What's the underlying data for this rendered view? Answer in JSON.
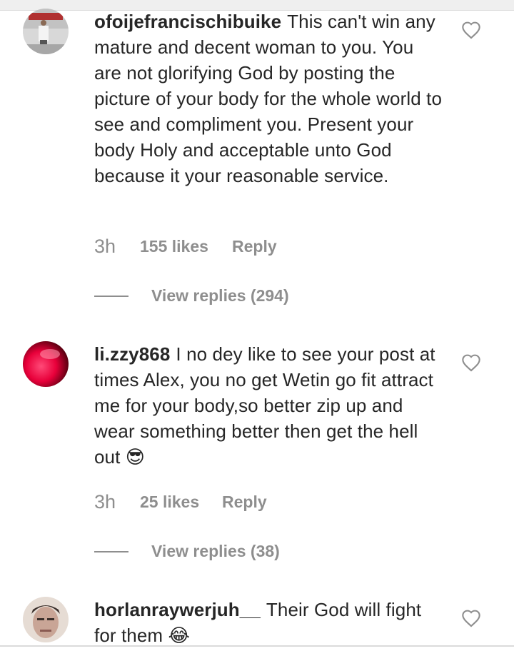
{
  "comments": [
    {
      "username": "ofoijefrancischibuike",
      "text": "This can't win any mature and decent woman to you. You are not glorifying God by posting the picture of your body for the whole world to see and compliment you. Present your body Holy and acceptable unto God because it your reasonable service.",
      "time": "3h",
      "likes": "155 likes",
      "reply": "Reply",
      "view_replies": "View replies (294)",
      "avatar_colors": [
        "#b9b9b9",
        "#e5e5e5"
      ]
    },
    {
      "username": "li.zzy868",
      "text": "I no dey like to see your post at times Alex, you no get Wetin go fit attract me for your body,so better zip up and wear something better then get the hell out",
      "emoji": "😎",
      "time": "3h",
      "likes": "25 likes",
      "reply": "Reply",
      "view_replies": "View replies (38)",
      "avatar_colors": [
        "#ff1a4e",
        "#5a0010"
      ]
    },
    {
      "username": "horlanraywerjuh__",
      "text": "Their God will fight for them",
      "emoji": "😂",
      "avatar_colors": [
        "#d9cfc8",
        "#6b5d5a"
      ]
    }
  ],
  "icons": {
    "heart": "heart-outline-icon"
  },
  "colors": {
    "text": "#262626",
    "secondary": "#8e8e8e"
  }
}
